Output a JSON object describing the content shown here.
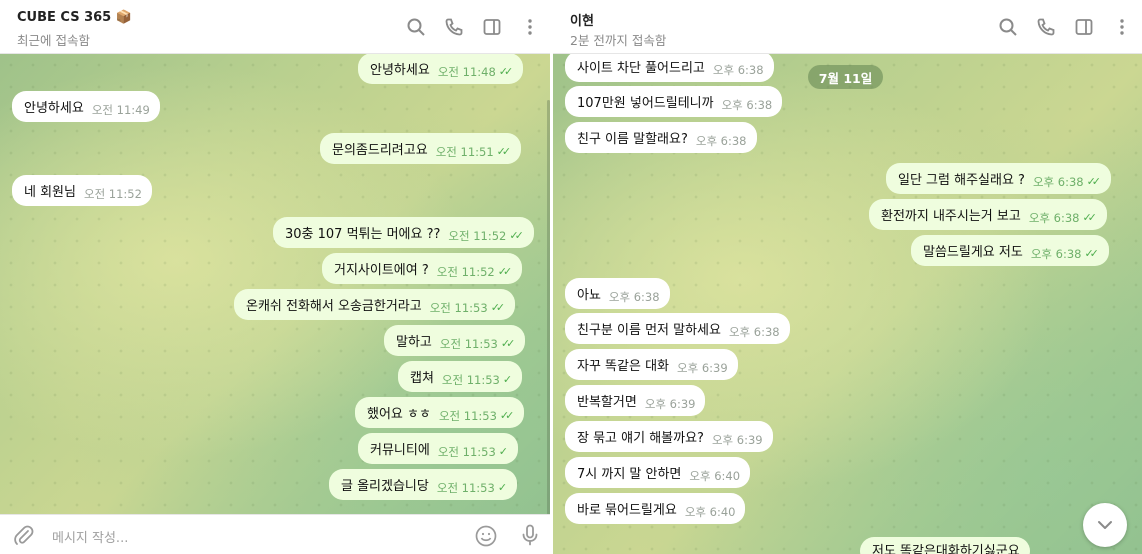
{
  "left_chat": {
    "header": {
      "title": "CUBE CS 365 📦",
      "status": "최근에 접속함"
    },
    "messages": [
      {
        "dir": "out",
        "text": "안녕하세요",
        "time": "오전 11:48",
        "read": true
      },
      {
        "dir": "in",
        "text": "안녕하세요",
        "time": "오전 11:49"
      },
      {
        "dir": "out",
        "text": "문의좀드리려고요",
        "time": "오전 11:51",
        "read": true
      },
      {
        "dir": "in",
        "text": "네 회원님",
        "time": "오전 11:52"
      },
      {
        "dir": "out",
        "text": "30충 107 먹튀는 머에요 ??",
        "time": "오전 11:52",
        "read": true
      },
      {
        "dir": "out",
        "text": "거지사이트에여 ?",
        "time": "오전 11:52",
        "read": true
      },
      {
        "dir": "out",
        "text": "온캐쉬 전화해서 오송금한거라고",
        "time": "오전 11:53",
        "read": true
      },
      {
        "dir": "out",
        "text": "말하고",
        "time": "오전 11:53",
        "read": true
      },
      {
        "dir": "out",
        "text": "캡쳐",
        "time": "오전 11:53",
        "read": false
      },
      {
        "dir": "out",
        "text": "했어요 ㅎㅎ",
        "time": "오전 11:53",
        "read": true
      },
      {
        "dir": "out",
        "text": "커뮤니티에",
        "time": "오전 11:53",
        "read": false
      },
      {
        "dir": "out",
        "text": "글 올리겠습니당",
        "time": "오전 11:53",
        "read": false
      }
    ],
    "composer": {
      "placeholder": "메시지 작성..."
    }
  },
  "right_chat": {
    "header": {
      "title": "이현",
      "status": "2분 전까지 접속함"
    },
    "date_badge": "7월 11일",
    "messages": [
      {
        "dir": "in",
        "text": "사이트 차단 풀어드리고",
        "time": "오후 6:38"
      },
      {
        "dir": "in",
        "text": "107만원 넣어드릴테니까",
        "time": "오후 6:38"
      },
      {
        "dir": "in",
        "text": "친구 이름 말할래요?",
        "time": "오후 6:38"
      },
      {
        "dir": "out",
        "text": "일단 그럼 해주실래요 ?",
        "time": "오후 6:38",
        "read": true
      },
      {
        "dir": "out",
        "text": "환전까지 내주시는거 보고",
        "time": "오후 6:38",
        "read": true
      },
      {
        "dir": "out",
        "text": "말씀드릴게요 저도",
        "time": "오후 6:38",
        "read": true
      },
      {
        "dir": "in",
        "text": "아뇨",
        "time": "오후 6:38"
      },
      {
        "dir": "in",
        "text": "친구분 이름 먼저 말하세요",
        "time": "오후 6:38"
      },
      {
        "dir": "in",
        "text": "자꾸 똑같은 대화",
        "time": "오후 6:39"
      },
      {
        "dir": "in",
        "text": "반복할거면",
        "time": "오후 6:39"
      },
      {
        "dir": "in",
        "text": "장 묶고 얘기 해볼까요?",
        "time": "오후 6:39"
      },
      {
        "dir": "in",
        "text": "7시 까지 말 안하면",
        "time": "오후 6:40"
      },
      {
        "dir": "in",
        "text": "바로 묶어드릴게요",
        "time": "오후 6:40"
      },
      {
        "dir": "out",
        "text": "저도 똑같은대화하기싫군요",
        "time": "",
        "read": false
      }
    ]
  },
  "icons": [
    "search-icon",
    "phone-icon",
    "sidebar-toggle-icon",
    "more-vertical-icon",
    "paperclip-icon",
    "emoji-icon",
    "microphone-icon",
    "chevron-down-icon"
  ],
  "colors": {
    "incoming_bubble": "#ffffff",
    "outgoing_bubble": "#effdde",
    "read_check": "#4fae4e",
    "time_in": "#9aa29a",
    "time_out": "#6fb06a"
  }
}
